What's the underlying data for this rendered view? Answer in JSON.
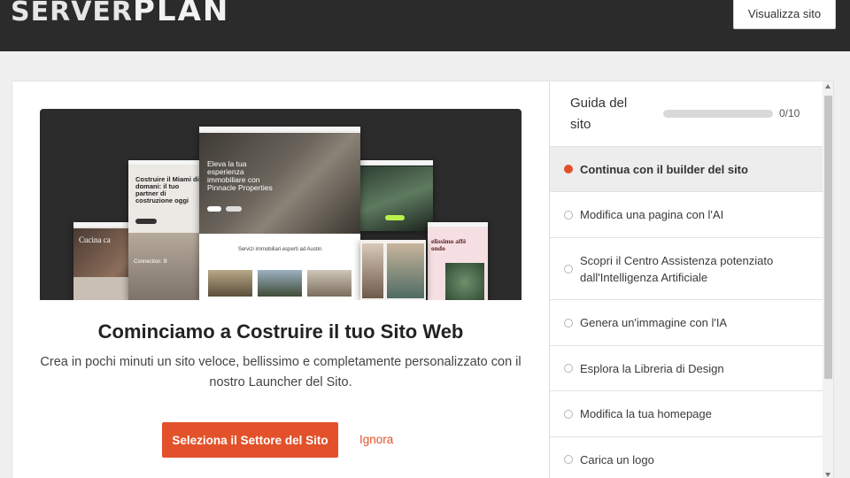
{
  "header": {
    "logo_part1": "SERVER",
    "logo_part2": "PLAN",
    "view_site_label": "Visualizza sito"
  },
  "main": {
    "headline": "Cominciamo a Costruire il tuo Sito Web",
    "subline": "Crea in pochi minuti un sito veloce, bellissimo e completamente personalizzato con il nostro Launcher del Sito.",
    "primary_button": "Seleziona il Settore del Sito",
    "ignore_link": "Ignora",
    "preview": {
      "center_heading": "Eleva la tua esperienza immobiliare con Pinnacle Properties",
      "center_caption": "Servizi immobiliari esperti ad Austin",
      "left_heading": "Costruire il Miami di domani: il tuo partner di costruzione oggi",
      "far_left_heading": "Cucina ca",
      "far_left_caption": "Connection: B",
      "right_heading": "elissimo affè ondo"
    }
  },
  "guide": {
    "title": "Guida del sito",
    "progress_text": "0/10",
    "progress_fraction": 0.0,
    "items": [
      {
        "label": "Continua con il builder del sito",
        "active": true
      },
      {
        "label": "Modifica una pagina con l'AI",
        "active": false
      },
      {
        "label": "Scopri il Centro Assistenza potenziato dall'Intelligenza Artificiale",
        "active": false
      },
      {
        "label": "Genera un'immagine con l'IA",
        "active": false
      },
      {
        "label": "Esplora la Libreria di Design",
        "active": false
      },
      {
        "label": "Modifica la tua homepage",
        "active": false
      },
      {
        "label": "Carica un logo",
        "active": false
      }
    ]
  },
  "colors": {
    "accent": "#e2512a",
    "header_bg": "#2b2b2b",
    "page_bg": "#f0f0f0"
  }
}
